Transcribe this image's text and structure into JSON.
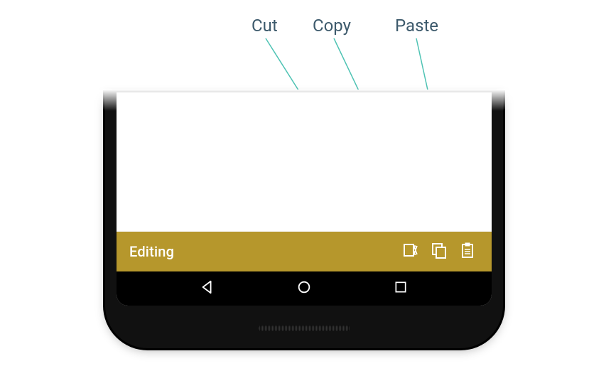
{
  "labels": {
    "cut": "Cut",
    "copy": "Copy",
    "paste": "Paste"
  },
  "appbar": {
    "title": "Editing"
  },
  "icons": {
    "cut": "cut-icon",
    "copy": "copy-icon",
    "paste": "paste-icon"
  },
  "colors": {
    "appbar": "#b6972c",
    "label": "#3d5a6c",
    "callout": "#4fc3b4"
  }
}
